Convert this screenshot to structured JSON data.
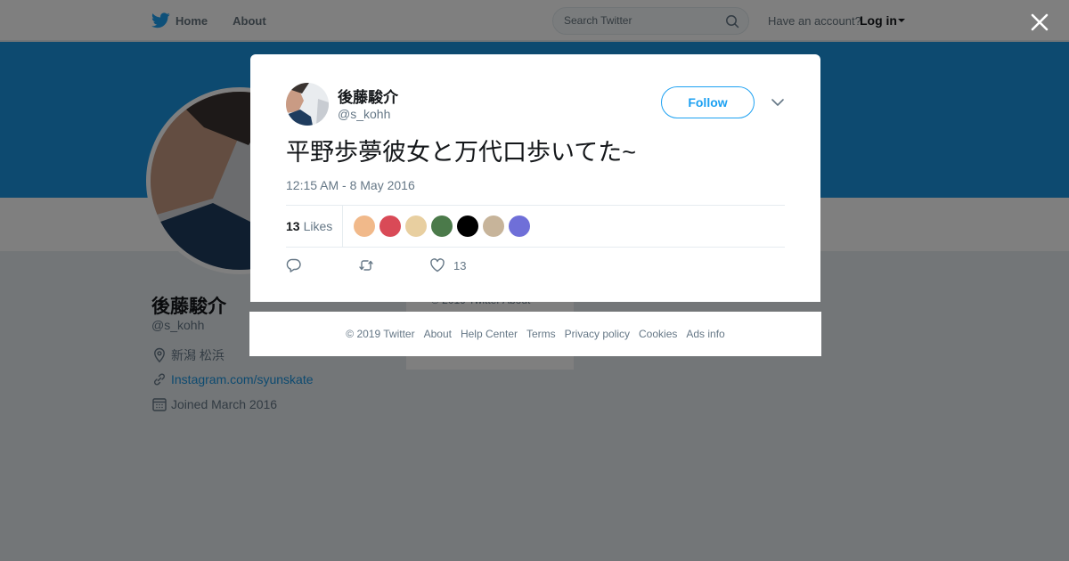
{
  "colors": {
    "accent": "#1da1f2",
    "banner": "#1b95e0",
    "muted": "#657786"
  },
  "nav": {
    "home_label": "Home",
    "about_label": "About",
    "search_placeholder": "Search Twitter",
    "account_prompt": "Have an account?",
    "login_label": "Log in"
  },
  "profile": {
    "name": "後藤駿介",
    "handle": "@s_kohh",
    "location": "新潟 松浜",
    "website": "Instagram.com/syunskate",
    "joined": "Joined March 2016",
    "mini_footer": "© 2019 Twitter   About"
  },
  "tweet": {
    "name": "後藤駿介",
    "handle": "@s_kohh",
    "follow_label": "Follow",
    "text": "平野歩夢彼女と万代口歩いてた~",
    "timestamp": "12:15 AM - 8 May 2016",
    "likes_count": "13",
    "likes_label": "Likes",
    "like_action_count": "13",
    "liker_avatars": [
      "#f1b98a",
      "#d94a57",
      "#e8cfa0",
      "#4b7a4a",
      "#000000",
      "#c7b49a",
      "#6f6fd8"
    ]
  },
  "footer": {
    "links": [
      "© 2019 Twitter",
      "About",
      "Help Center",
      "Terms",
      "Privacy policy",
      "Cookies",
      "Ads info"
    ]
  }
}
